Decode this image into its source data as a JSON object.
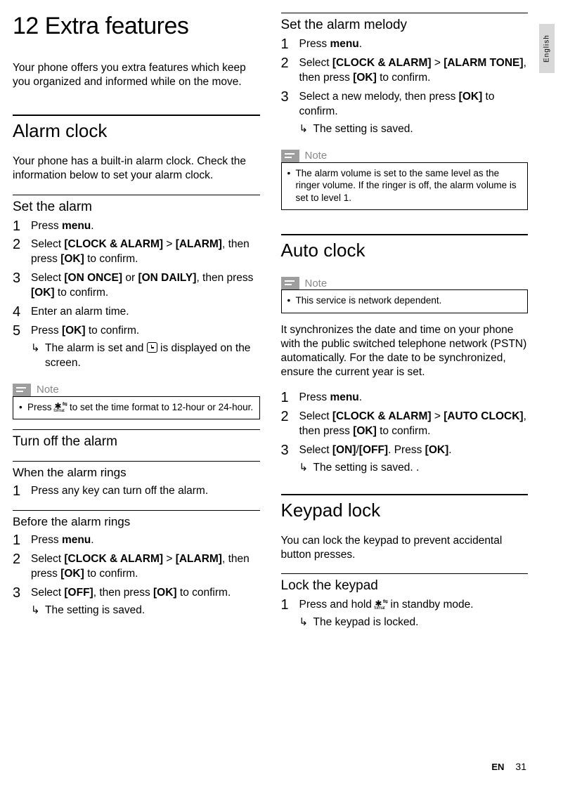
{
  "lang_tab": "English",
  "chapter_title": "12 Extra features",
  "intro": "Your phone offers you extra features which keep you organized and informed while on the move.",
  "alarm_clock": {
    "heading": "Alarm clock",
    "body": "Your phone has a built-in alarm clock. Check the information below to set your alarm clock.",
    "set_alarm": {
      "heading": "Set the alarm",
      "s1_a": "Press ",
      "s1_b": "menu",
      "s1_c": ".",
      "s2_a": "Select ",
      "s2_b": "[CLOCK & ALARM]",
      "s2_c": " > ",
      "s2_d": "[ALARM]",
      "s2_e": ", then press ",
      "s2_f": "[OK]",
      "s2_g": " to confirm.",
      "s3_a": "Select ",
      "s3_b": "[ON ONCE]",
      "s3_c": " or ",
      "s3_d": "[ON DAILY]",
      "s3_e": ", then press ",
      "s3_f": "[OK]",
      "s3_g": " to confirm.",
      "s4": "Enter an alarm time.",
      "s5_a": "Press ",
      "s5_b": "[OK]",
      "s5_c": " to confirm.",
      "s5_res_a": "The alarm is set and ",
      "s5_res_b": " is displayed on the screen."
    },
    "note1": {
      "label": "Note",
      "text_a": "Press ",
      "text_b": " to set the time format to 12-hour or 24-hour."
    },
    "turn_off": {
      "heading": "Turn off the alarm",
      "when_rings": {
        "heading": "When the alarm rings",
        "s1": "Press any key can turn off the alarm."
      },
      "before_rings": {
        "heading": "Before the alarm rings",
        "s1_a": "Press ",
        "s1_b": "menu",
        "s1_c": ".",
        "s2_a": "Select ",
        "s2_b": "[CLOCK & ALARM]",
        "s2_c": " > ",
        "s2_d": "[ALARM]",
        "s2_e": ", then press ",
        "s2_f": "[OK]",
        "s2_g": " to confirm.",
        "s3_a": "Select ",
        "s3_b": "[OFF]",
        "s3_c": ", then press ",
        "s3_d": "[OK]",
        "s3_e": " to confirm.",
        "s3_res": "The setting is saved."
      }
    }
  },
  "melody": {
    "heading": "Set the alarm melody",
    "s1_a": "Press ",
    "s1_b": "menu",
    "s1_c": ".",
    "s2_a": "Select ",
    "s2_b": "[CLOCK & ALARM]",
    "s2_c": " > ",
    "s2_d": "[ALARM TONE]",
    "s2_e": ", then press ",
    "s2_f": "[OK]",
    "s2_g": " to confirm.",
    "s3_a": "Select a new melody, then press ",
    "s3_b": "[OK]",
    "s3_c": " to confirm.",
    "s3_res": "The setting is saved.",
    "note": {
      "label": "Note",
      "text": "The alarm volume is set to the same level as the ringer volume. If the ringer is off, the alarm volume is set to level 1."
    }
  },
  "auto_clock": {
    "heading": "Auto clock",
    "note": {
      "label": "Note",
      "text": "This service is network dependent."
    },
    "body": "It synchronizes the date and time on your phone with the public switched telephone network (PSTN) automatically. For the date to be synchronized, ensure the current year is set.",
    "s1_a": "Press ",
    "s1_b": "menu",
    "s1_c": ".",
    "s2_a": "Select ",
    "s2_b": "[CLOCK & ALARM]",
    "s2_c": " > ",
    "s2_d": "[AUTO CLOCK]",
    "s2_e": ", then press ",
    "s2_f": "[OK]",
    "s2_g": " to confirm.",
    "s3_a": "Select ",
    "s3_b": "[ON]",
    "s3_c": "/",
    "s3_d": "[OFF]",
    "s3_e": ". Press ",
    "s3_f": "[OK]",
    "s3_g": ".",
    "s3_res": "The setting is saved. ."
  },
  "keypad": {
    "heading": "Keypad lock",
    "body": "You can lock the keypad to prevent accidental button presses.",
    "lock": {
      "heading": "Lock the keypad",
      "s1_a": "Press and hold ",
      "s1_b": " in standby mode.",
      "s1_res": "The keypad is locked."
    }
  },
  "footer": {
    "lang": "EN",
    "page": "31"
  }
}
